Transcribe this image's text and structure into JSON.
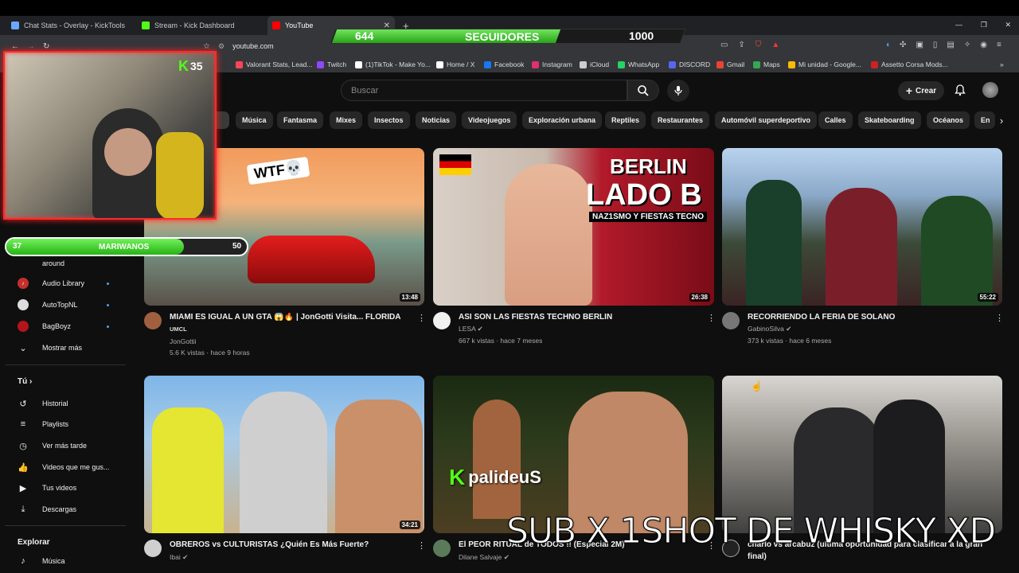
{
  "browser": {
    "tabs": [
      {
        "label": "Chat Stats - Overlay - KickTools",
        "color": "#6aa7ff"
      },
      {
        "label": "Stream - Kick Dashboard",
        "color": "#53fc18"
      },
      {
        "label": "YouTube",
        "color": "#ff0000"
      }
    ],
    "new_tab": "+",
    "url": "youtube.com",
    "bookmarks": [
      {
        "label": "Valorant Stats, Lead...",
        "color": "#ff4655"
      },
      {
        "label": "Twitch",
        "color": "#9146ff"
      },
      {
        "label": "(1)TikTok - Make Yo...",
        "color": "#ffffff"
      },
      {
        "label": "Home / X",
        "color": "#ffffff"
      },
      {
        "label": "Facebook",
        "color": "#1877f2"
      },
      {
        "label": "Instagram",
        "color": "#e1306c"
      },
      {
        "label": "iCloud",
        "color": "#cccccc"
      },
      {
        "label": "WhatsApp",
        "color": "#25d366"
      },
      {
        "label": "DISCORD",
        "color": "#5865f2"
      },
      {
        "label": "Gmail",
        "color": "#ea4335"
      },
      {
        "label": "Maps",
        "color": "#34a853"
      },
      {
        "label": "Mi unidad - Google...",
        "color": "#fbbc04"
      },
      {
        "label": "Assetto Corsa Mods...",
        "color": "#cc2222"
      }
    ]
  },
  "overlay": {
    "followers_current": "644",
    "followers_label": "SEGUIDORES",
    "followers_goal": "1000",
    "followers_progress": 0.644,
    "kick_badge": "35",
    "subgoal_current": "37",
    "subgoal_label": "MARIWANOS",
    "subgoal_goal": "50",
    "subgoal_progress": 0.74,
    "caption": "SUB X 1SHOT DE WHISKY XD"
  },
  "youtube": {
    "search_placeholder": "Buscar",
    "create_label": "Crear",
    "chips": [
      "Música",
      "Fantasma",
      "Mixes",
      "Insectos",
      "Noticias",
      "Videojuegos",
      "Exploración urbana",
      "Reptiles",
      "Restaurantes",
      "Automóvil superdeportivo",
      "Calles",
      "Skateboarding",
      "Océanos",
      "En "
    ],
    "sidebar": {
      "subs": [
        {
          "label": "around",
          "dot": false
        },
        {
          "label": "Audio Library",
          "dot": true
        },
        {
          "label": "AutoTopNL",
          "dot": true
        },
        {
          "label": "BagBoyz",
          "dot": true
        }
      ],
      "show_more": "Mostrar más",
      "you_header": "Tú",
      "you_items": [
        "Historial",
        "Playlists",
        "Ver más tarde",
        "Videos que me gus...",
        "Tus videos",
        "Descargas"
      ],
      "explore_header": "Explorar",
      "explore_items": [
        "Música"
      ]
    },
    "videos": [
      {
        "title": "MIAMI ES IGUAL A UN GTA 😱🔥 | JonGotti Visita... FLORIDA",
        "subtitle": "UMCL",
        "channel": "JonGottii",
        "meta": "5.6 K vistas · hace 9 horas",
        "duration": "13:48",
        "verified": false
      },
      {
        "title": "ASI SON LAS FIESTAS TECHNO BERLIN",
        "subtitle": "",
        "channel": "LESA",
        "meta": "667 k vistas · hace 7 meses",
        "duration": "26:38",
        "verified": true
      },
      {
        "title": "RECORRIENDO LA FERIA DE SOLANO",
        "subtitle": "",
        "channel": "GabinoSilva",
        "meta": "373 k vistas · hace 6 meses",
        "duration": "55:22",
        "verified": true
      },
      {
        "title": "OBREROS vs CULTURISTAS ¿Quién Es Más Fuerte?",
        "subtitle": "",
        "channel": "Ibai",
        "meta": "",
        "duration": "34:21",
        "verified": true
      },
      {
        "title": "El PEOR RITUAL de TODOS !! (Especial 2M)",
        "subtitle": "",
        "channel": "Dilane Salvaje",
        "meta": "",
        "duration": "",
        "verified": true
      },
      {
        "title": "charlo vs arcabuz (ultima oportunidad para clasificar a la gran",
        "subtitle": "final)",
        "channel": "",
        "meta": "",
        "duration": "",
        "verified": false
      }
    ],
    "thumb_text": {
      "wtf": "WTF💀",
      "berlin": "BERLIN",
      "lado_b": "LADO B",
      "berlin_sub": "NAZ1SMO Y FIESTAS TECNO",
      "palideus": "palideuS"
    }
  }
}
